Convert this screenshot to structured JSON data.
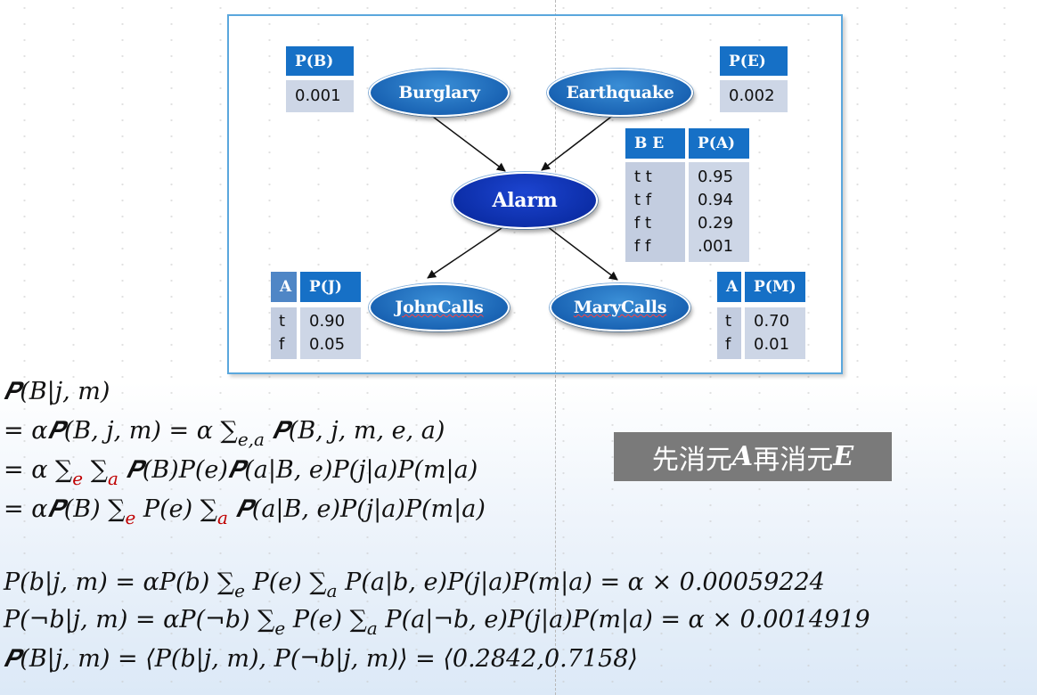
{
  "nodes": {
    "burglary": "Burglary",
    "earthquake": "Earthquake",
    "alarm": "Alarm",
    "johncalls": "JohnCalls",
    "marycalls": "MaryCalls"
  },
  "cpt_b": {
    "header": "P(B)",
    "value": "0.001"
  },
  "cpt_e": {
    "header": "P(E)",
    "value": "0.002"
  },
  "cpt_a": {
    "header_cond": "B E",
    "header_prob": "P(A)",
    "rows": [
      {
        "cond": "t t",
        "prob": "0.95"
      },
      {
        "cond": "t f",
        "prob": "0.94"
      },
      {
        "cond": "f t",
        "prob": "0.29"
      },
      {
        "cond": "f f",
        "prob": ".001"
      }
    ]
  },
  "cpt_j": {
    "header_cond": "A",
    "header_prob": "P(J)",
    "rows": [
      {
        "cond": "t",
        "prob": "0.90"
      },
      {
        "cond": "f",
        "prob": "0.05"
      }
    ]
  },
  "cpt_m": {
    "header_cond": "A",
    "header_prob": "P(M)",
    "rows": [
      {
        "cond": "t",
        "prob": "0.70"
      },
      {
        "cond": "f",
        "prob": "0.01"
      }
    ]
  },
  "badge": {
    "pre": "先消元",
    "var1": "A",
    "mid": "再消元",
    "var2": "E"
  },
  "equations": {
    "line1": "𝑷(𝐵|𝑗, 𝑚)",
    "line2": "= 𝛼𝑷(𝐵, 𝑗, 𝑚) = 𝛼 ∑",
    "line2_sub": "𝑒,𝑎",
    "line2_end": " 𝑷(𝐵, 𝑗, 𝑚, 𝑒, 𝑎)",
    "line3_a": "= 𝛼 ∑",
    "line3_sub1": "𝑒",
    "line3_b": " ∑",
    "line3_sub2": "𝑎",
    "line3_end": " 𝑷(𝐵)𝑃(𝑒)𝑷(𝑎|𝐵, 𝑒)𝑃(𝑗|𝑎)𝑃(𝑚|𝑎)",
    "line4_a": "= 𝛼𝑷(𝐵) ∑",
    "line4_sub1": "𝑒",
    "line4_b": " 𝑃(𝑒) ∑",
    "line4_sub2": "𝑎",
    "line4_end": " 𝑷(𝑎|𝐵, 𝑒)𝑃(𝑗|𝑎)𝑃(𝑚|𝑎)",
    "line5_a": "𝑃(𝑏|𝑗, 𝑚) = 𝛼𝑃(𝑏) ∑",
    "line5_sub1": "𝑒",
    "line5_b": " 𝑃(𝑒) ∑",
    "line5_sub2": "𝑎",
    "line5_end": " 𝑃(𝑎|𝑏, 𝑒)𝑃(𝑗|𝑎)𝑃(𝑚|𝑎) = 𝛼 × 0.00059224",
    "line6_a": "𝑃(¬𝑏|𝑗, 𝑚) = 𝛼𝑃(¬𝑏) ∑",
    "line6_sub1": "𝑒",
    "line6_b": " 𝑃(𝑒) ∑",
    "line6_sub2": "𝑎",
    "line6_end": " 𝑃(𝑎|¬𝑏, 𝑒)𝑃(𝑗|𝑎)𝑃(𝑚|𝑎) = 𝛼 × 0.0014919",
    "line7": "𝑷(𝐵|𝑗, 𝑚) = ⟨𝑃(𝑏|𝑗, 𝑚), 𝑃(¬𝑏|𝑗, 𝑚)⟩ = ⟨0.2842,0.7158⟩"
  }
}
